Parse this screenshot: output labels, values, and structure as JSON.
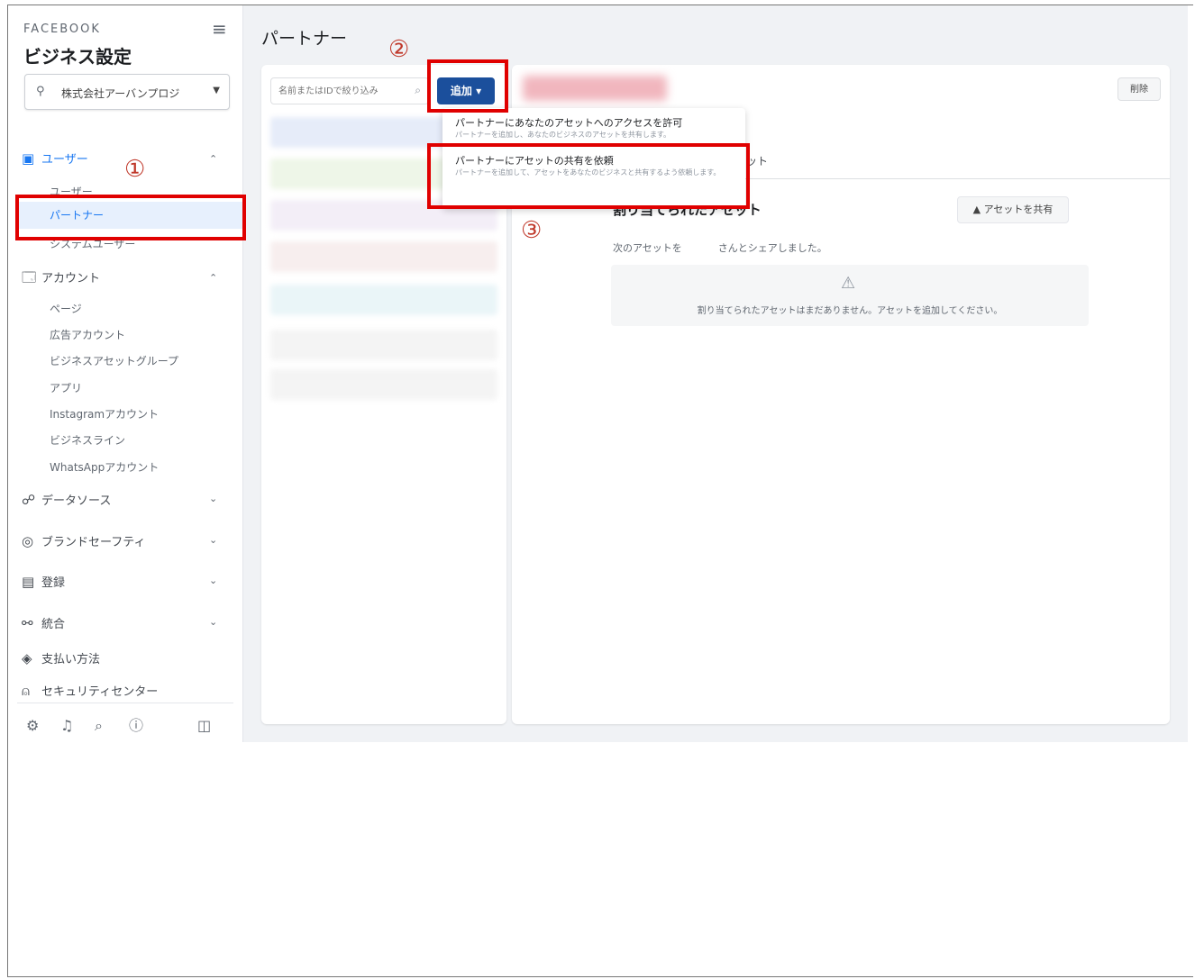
{
  "sidebar": {
    "brand": "FACEBOOK",
    "title": "ビジネス設定",
    "business_name": "株式会社アーバンプロジ",
    "sections": {
      "users": "ユーザー",
      "users_sub": [
        "ユーザー",
        "パートナー",
        "システムユーザー"
      ],
      "accounts": "アカウント",
      "accounts_sub": [
        "ページ",
        "広告アカウント",
        "ビジネスアセットグループ",
        "アプリ",
        "Instagramアカウント",
        "ビジネスライン",
        "WhatsAppアカウント"
      ],
      "data_sources": "データソース",
      "brand_safety": "ブランドセーフティ",
      "registration": "登録",
      "integrations": "統合",
      "payment_methods": "支払い方法",
      "security_center": "セキュリティセンター"
    }
  },
  "main": {
    "heading": "パートナー",
    "search_placeholder": "名前またはIDで絞り込み",
    "add_button": "追加 ▾",
    "delete_button": "削除",
    "tab_fragment": "ット",
    "assets_heading": "割り当てられたアセット",
    "share_asset_button": "アセットを共有",
    "shared_text_prefix": "次のアセットを",
    "shared_text_suffix": "さんとシェアしました。",
    "empty_message": "割り当てられたアセットはまだありません。アセットを追加してください。"
  },
  "dropdown": {
    "items": [
      {
        "title": "パートナーにあなたのアセットへのアクセスを許可",
        "desc": "パートナーを追加し、あなたのビジネスのアセットを共有します。"
      },
      {
        "title": "パートナーにアセットの共有を依頼",
        "desc": "パートナーを追加して、アセットをあなたのビジネスと共有するよう依頼します。"
      }
    ]
  },
  "annotations": {
    "step1": "①",
    "step2": "②",
    "step3": "③",
    "color": "#e00000"
  },
  "colors": {
    "accent": "#1877f2",
    "add_button_bg": "#1b4f9c",
    "background": "#f0f2f5"
  }
}
